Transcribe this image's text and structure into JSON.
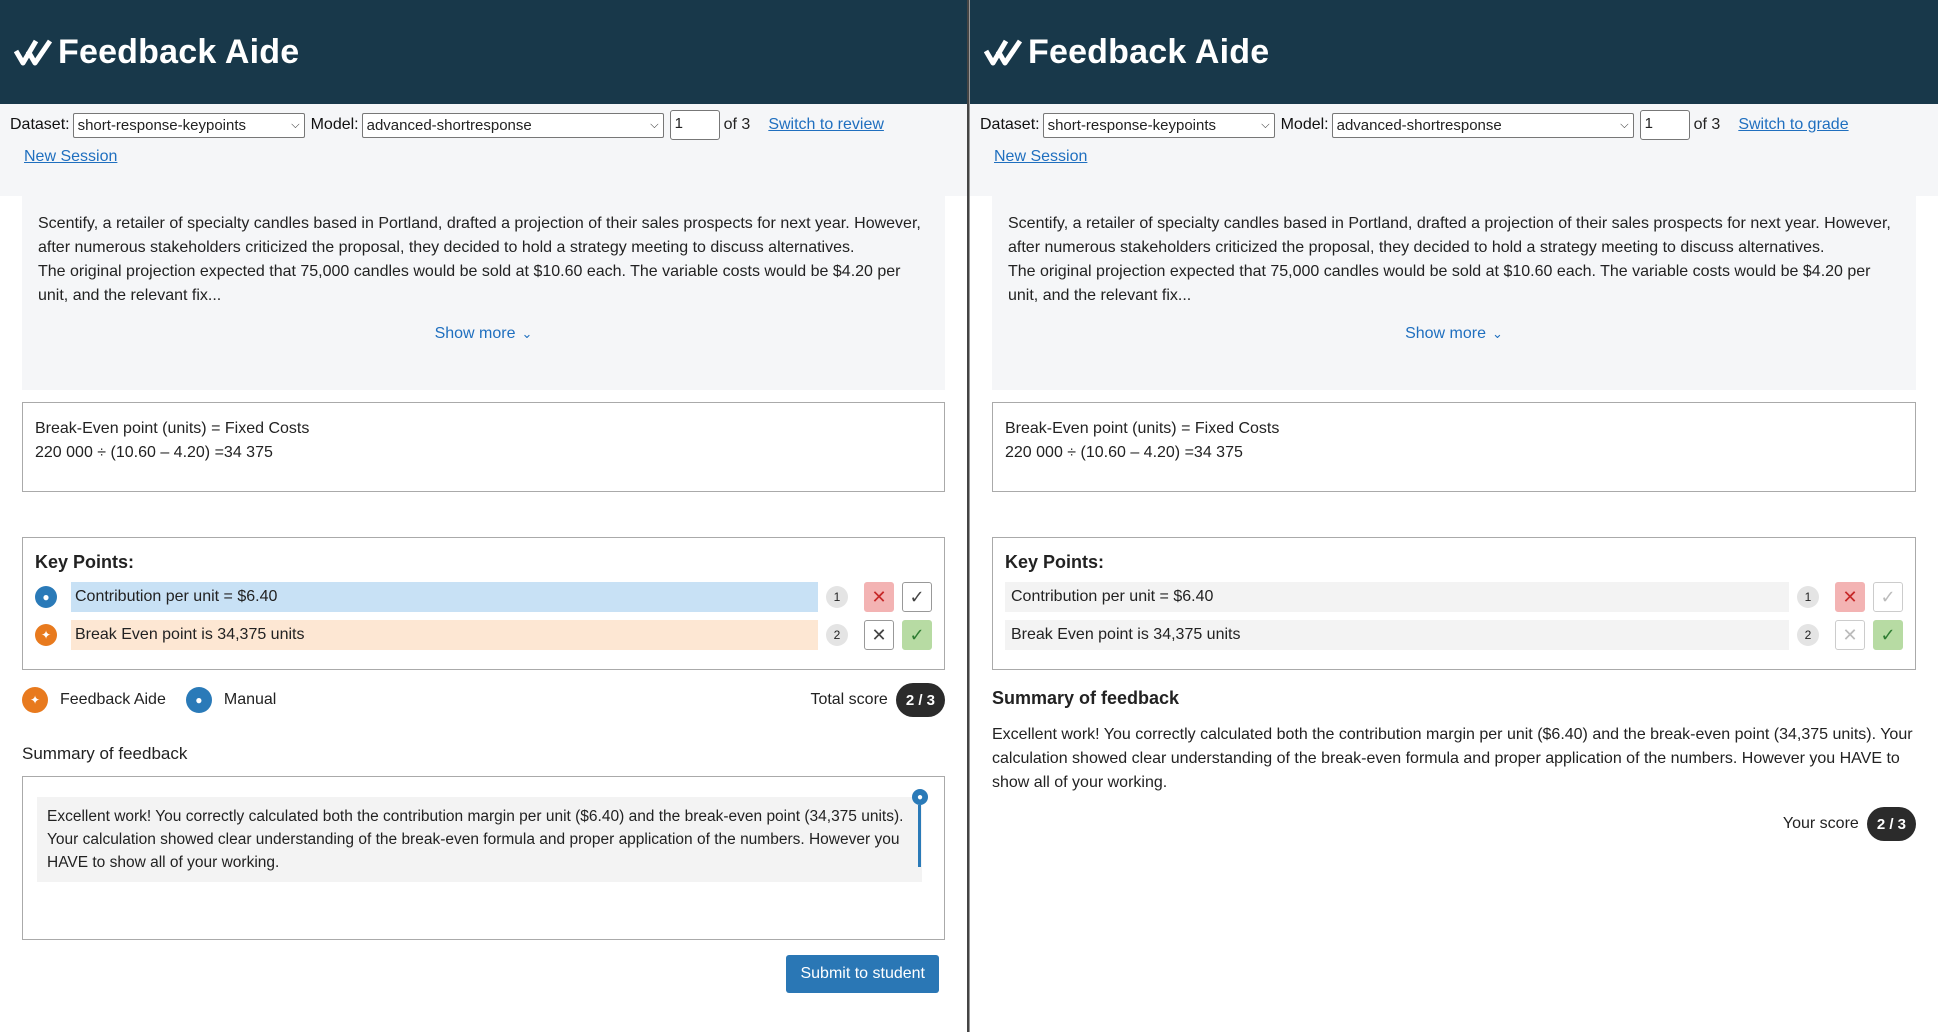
{
  "brand": {
    "name": "Feedback Aide"
  },
  "controls": {
    "dataset_label": "Dataset:",
    "dataset_value": "short-response-keypoints",
    "model_label": "Model:",
    "model_value": "advanced-shortresponse",
    "item_number": "1",
    "of_total": "of 3",
    "new_session": "New Session"
  },
  "left": {
    "switch_link": "Switch to review"
  },
  "right": {
    "switch_link": "Switch to grade"
  },
  "stimulus": {
    "p1": "Scentify, a retailer of specialty candles based in Portland, drafted a projection of their sales prospects for next year. However, after numerous stakeholders criticized the proposal, they decided to hold a strategy meeting to discuss alternatives.",
    "p2": "The original projection expected that 75,000 candles would be sold at $10.60 each. The variable costs would be $4.20 per unit, and the relevant fix...",
    "show_more": "Show more"
  },
  "response": {
    "line1": "Break-Even point (units) = Fixed Costs",
    "line2": "220 000 ÷ (10.60 – 4.20) =34 375"
  },
  "keypoints": {
    "title": "Key Points:",
    "items": [
      {
        "text": "Contribution per unit = $6.40",
        "count": "1",
        "source": "manual",
        "status": "rejected"
      },
      {
        "text": "Break Even point is 34,375 units",
        "count": "2",
        "source": "feedback-aide",
        "status": "accepted"
      }
    ]
  },
  "legend": {
    "aide_label": "Feedback Aide",
    "manual_label": "Manual",
    "total_label": "Total score",
    "score": "2 / 3"
  },
  "summary": {
    "title": "Summary of feedback",
    "text": "Excellent work! You correctly calculated both the contribution margin per unit ($6.40) and the break-even point (34,375 units). Your calculation showed clear understanding of the break-even formula and proper application of the numbers. However you HAVE to show all of your working."
  },
  "submit_label": "Submit to student",
  "your_score_label": "Your score",
  "your_score": "2 / 3",
  "colors": {
    "header": "#18384a",
    "link": "#1f6fbf",
    "manual": "#2a7ab8",
    "aide": "#e87a1e",
    "submit": "#2a77b5"
  }
}
